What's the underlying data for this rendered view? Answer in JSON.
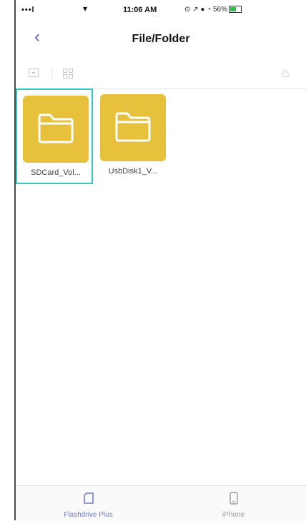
{
  "status_bar": {
    "signal": "•••l",
    "wifi": "▾",
    "time": "11:06 AM",
    "right": "⊙ ↗ ● ◔ 56%"
  },
  "nav": {
    "back_icon": "chevron-left-icon",
    "title": "File/Folder"
  },
  "toolbar": {
    "icons": [
      "new-folder-icon",
      "grid-view-icon",
      "home-icon"
    ]
  },
  "folders": [
    {
      "label": "SDCard_Vol...",
      "selected": true
    },
    {
      "label": "UsbDisk1_V...",
      "selected": false
    }
  ],
  "tabs": [
    {
      "label": "Flashdrive Plus",
      "active": true
    },
    {
      "label": "iPhone",
      "active": false
    }
  ],
  "colors": {
    "folder": "#e8c13c",
    "selection": "#2fc9c1",
    "accent": "#5b5cc6"
  }
}
